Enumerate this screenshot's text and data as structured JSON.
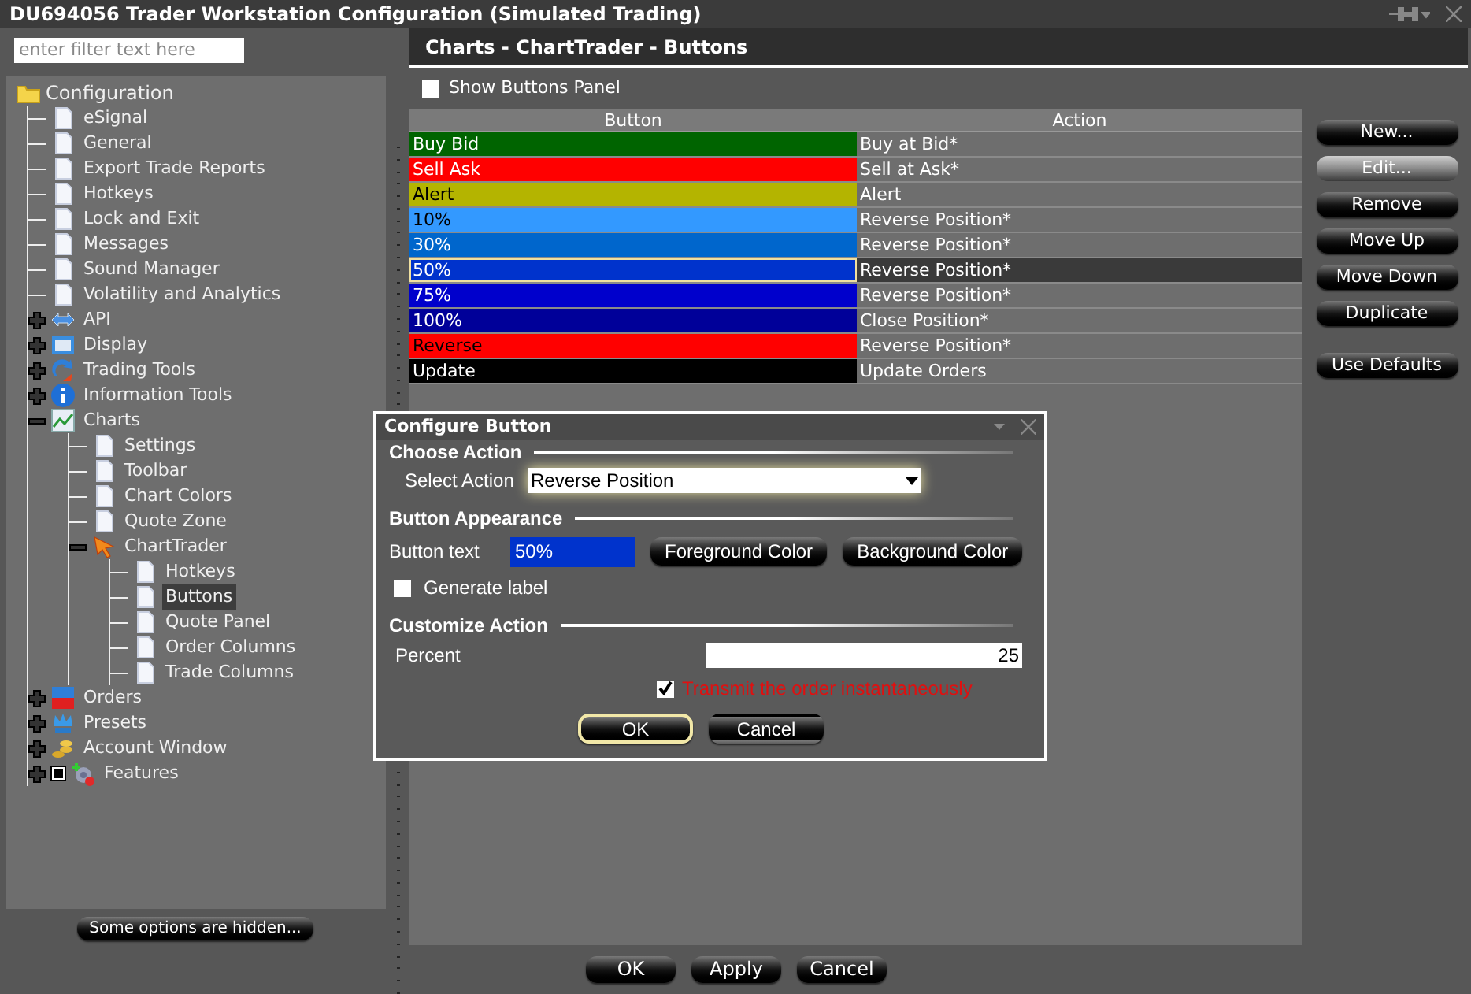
{
  "window": {
    "title": "DU694056 Trader Workstation Configuration (Simulated Trading)"
  },
  "filter": {
    "placeholder": "enter filter text here"
  },
  "tree": {
    "label": "Configuration",
    "children": [
      {
        "label": "eSignal",
        "kind": "page",
        "selected": false
      },
      {
        "label": "General",
        "kind": "page",
        "selected": false
      },
      {
        "label": "Export Trade Reports",
        "kind": "page",
        "selected": false
      },
      {
        "label": "Hotkeys",
        "kind": "page",
        "selected": false
      },
      {
        "label": "Lock and Exit",
        "kind": "page",
        "selected": false
      },
      {
        "label": "Messages",
        "kind": "page",
        "selected": false
      },
      {
        "label": "Sound Manager",
        "kind": "page",
        "selected": false
      },
      {
        "label": "Volatility and Analytics",
        "kind": "page",
        "selected": false
      },
      {
        "label": "API",
        "kind": "api",
        "expanded": false,
        "selected": false
      },
      {
        "label": "Display",
        "kind": "display",
        "expanded": false,
        "selected": false
      },
      {
        "label": "Trading Tools",
        "kind": "trading",
        "expanded": false,
        "selected": false
      },
      {
        "label": "Information Tools",
        "kind": "info",
        "expanded": false,
        "selected": false
      },
      {
        "label": "Charts",
        "kind": "charts",
        "expanded": true,
        "selected": false,
        "children": [
          {
            "label": "Settings",
            "kind": "page",
            "selected": false
          },
          {
            "label": "Toolbar",
            "kind": "page",
            "selected": false
          },
          {
            "label": "Chart Colors",
            "kind": "page",
            "selected": false
          },
          {
            "label": "Quote Zone",
            "kind": "page",
            "selected": false
          },
          {
            "label": "ChartTrader",
            "kind": "charttrader",
            "expanded": true,
            "selected": false,
            "children": [
              {
                "label": "Hotkeys",
                "kind": "page",
                "selected": false
              },
              {
                "label": "Buttons",
                "kind": "page",
                "selected": true
              },
              {
                "label": "Quote Panel",
                "kind": "page",
                "selected": false
              },
              {
                "label": "Order Columns",
                "kind": "page",
                "selected": false
              },
              {
                "label": "Trade Columns",
                "kind": "page",
                "selected": false
              }
            ]
          }
        ]
      },
      {
        "label": "Orders",
        "kind": "orders",
        "expanded": false,
        "selected": false
      },
      {
        "label": "Presets",
        "kind": "presets",
        "expanded": false,
        "selected": false
      },
      {
        "label": "Account Window",
        "kind": "account",
        "expanded": false,
        "selected": false
      },
      {
        "label": "Features",
        "kind": "features",
        "expanded": false,
        "selected": false,
        "checked": true
      }
    ]
  },
  "hidden_options_button": "Some options are hidden...",
  "panel": {
    "title": "Charts - ChartTrader - Buttons",
    "show_buttons_panel": {
      "label": "Show Buttons Panel",
      "checked": false
    }
  },
  "table": {
    "columns": [
      "Button",
      "Action"
    ],
    "rows": [
      {
        "button": "Buy Bid",
        "action": "Buy at Bid*",
        "color": "#006400",
        "dark_text": false,
        "selected": false
      },
      {
        "button": "Sell Ask",
        "action": "Sell at Ask*",
        "color": "#ff0000",
        "dark_text": false,
        "selected": false
      },
      {
        "button": "Alert",
        "action": "Alert",
        "color": "#b4b400",
        "dark_text": true,
        "selected": false
      },
      {
        "button": "10%",
        "action": "Reverse Position*",
        "color": "#3399ff",
        "dark_text": true,
        "selected": false
      },
      {
        "button": "30%",
        "action": "Reverse Position*",
        "color": "#0066cc",
        "dark_text": false,
        "selected": false
      },
      {
        "button": "50%",
        "action": "Reverse Position*",
        "color": "#0033cc",
        "dark_text": false,
        "selected": true
      },
      {
        "button": "75%",
        "action": "Reverse Position*",
        "color": "#0000cc",
        "dark_text": false,
        "selected": false
      },
      {
        "button": "100%",
        "action": "Close Position*",
        "color": "#000099",
        "dark_text": false,
        "selected": false
      },
      {
        "button": "Reverse",
        "action": "Reverse Position*",
        "color": "#ff0000",
        "dark_text": true,
        "selected": false
      },
      {
        "button": "Update",
        "action": "Update Orders",
        "color": "#000000",
        "dark_text": false,
        "selected": false
      }
    ]
  },
  "side_buttons": [
    {
      "label": "New...",
      "highlighted": false
    },
    {
      "label": "Edit...",
      "highlighted": true
    },
    {
      "label": "Remove",
      "highlighted": false
    },
    {
      "label": "Move Up",
      "highlighted": false
    },
    {
      "label": "Move Down",
      "highlighted": false
    },
    {
      "label": "Duplicate",
      "highlighted": false
    },
    {
      "label": "Use Defaults",
      "highlighted": false
    }
  ],
  "dialog": {
    "title": "Configure Button",
    "choose_action": {
      "heading": "Choose Action",
      "label": "Select Action",
      "value": "Reverse Position"
    },
    "appearance": {
      "heading": "Button Appearance",
      "label": "Button text",
      "value": "50%",
      "buttons": [
        "Foreground Color",
        "Background Color"
      ],
      "generate_label": {
        "label": "Generate label",
        "checked": false
      }
    },
    "customize": {
      "heading": "Customize Action",
      "label": "Percent",
      "value": "25",
      "transmit": {
        "label": "Transmit the order instantaneously",
        "checked": true
      }
    },
    "buttons": [
      {
        "label": "OK",
        "focused": true
      },
      {
        "label": "Cancel",
        "focused": false
      }
    ]
  },
  "footer_buttons": [
    "OK",
    "Apply",
    "Cancel"
  ]
}
